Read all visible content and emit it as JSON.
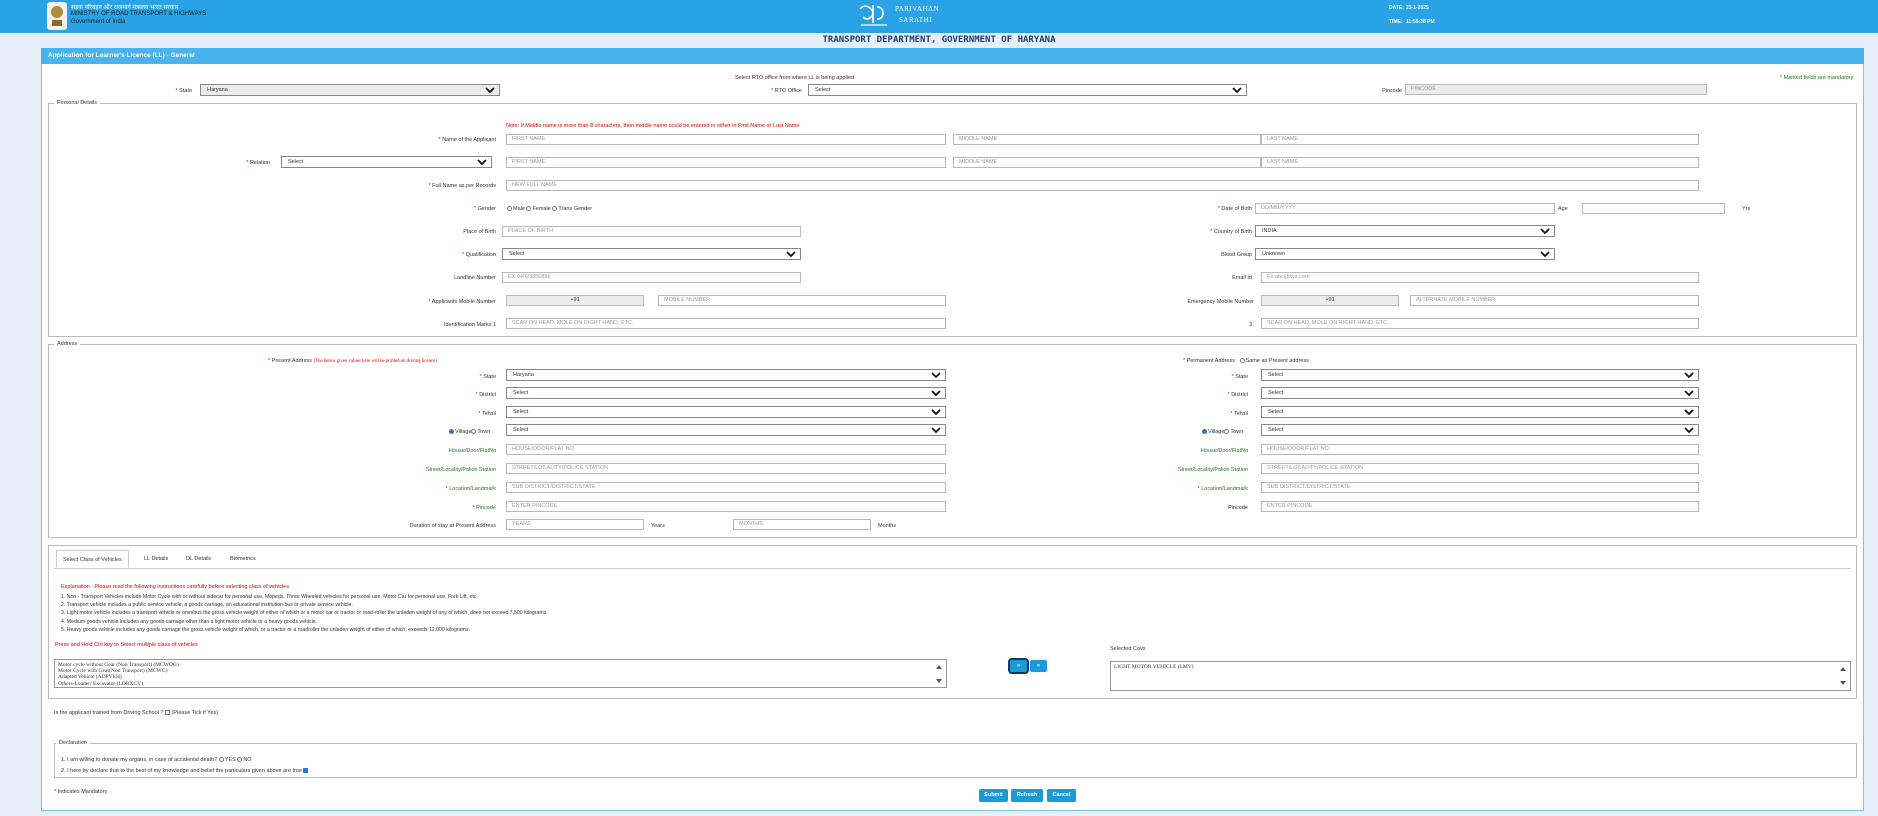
{
  "header": {
    "ministry_hindi": "सड़क परिवहन और राजमार्ग मंत्रालय भारत सरकार",
    "ministry": "MINISTRY OF ROAD TRANSPORT & HIGHWAYS",
    "gov": "Government of India",
    "logo_hindi": "परिवहन",
    "logo_line1": "PARIVAHAN",
    "logo_line2": "SARATHI",
    "date_label": "DATE:",
    "date_value": "23-1-2025",
    "time_label": "TIME:",
    "time_value": "11:55:38 PM",
    "department": "TRANSPORT DEPARTMENT, GOVERNMENT OF HARYANA"
  },
  "form": {
    "title": "Application for Learner's Licence (LL) - General",
    "rto_note": "Select RTO office from where LL is being applied",
    "mandatory_note": "* Marked fields are mandatory",
    "state_label": "State",
    "state_value": "Haryana",
    "rto_label": "RTO Office",
    "rto_value": "Select",
    "pincode_label": "Pincode",
    "pincode_placeholder": "PINCODE"
  },
  "personal": {
    "legend": "Personal Details",
    "middle_name_note": "Note: If Middle name is more than 8 characters, then middle name could be entered in either in First Name or Last Name",
    "name_label": "Name of the Applicant",
    "first_name": "FIRST NAME",
    "middle_name": "MIDDLE NAME",
    "last_name": "LAST NAME",
    "relation_label": "Relation",
    "relation_value": "Select",
    "fullname_label": "Full Name as per Records",
    "fullname_placeholder": "NEW FULL NAME",
    "gender_label": "Gender",
    "gender_male": "Male",
    "gender_female": "Female",
    "gender_trans": "Trans Gender",
    "dob_label": "Date of Birth",
    "dob_placeholder": "DD/MM/YYYY",
    "age_label": "Age",
    "age_unit": "Yrs",
    "pob_label": "Place of Birth",
    "pob_placeholder": "PLACE OF BIRTH",
    "country_label": "Country of Birth",
    "country_value": "INDIA",
    "qual_label": "Qualification",
    "qual_value": "Select",
    "blood_label": "Blood Group",
    "blood_value": "Unknown",
    "landline_label": "Landline Number",
    "landline_placeholder": "EX:04023856856",
    "email_label": "Email Id",
    "email_placeholder": "Ex:abc@xyz.com",
    "mobile_label": "Applicants Mobile Number",
    "mobile_code": "+91",
    "mobile_placeholder": "MOBILE NUMBER",
    "emergency_label": "Emergency Mobile Number",
    "emergency_code": "+91",
    "emergency_placeholder": "ALTERNATE MOBILE NUMBER",
    "idmark1_label": "Identification Marks 1",
    "idmark_placeholder": "SCAR ON HEAD, MOLE ON RIGHT HAND, ETC.",
    "idmark2_label": "2."
  },
  "address": {
    "legend": "Address",
    "present_label": "Present Address",
    "present_note": "(The below given values here will be printed on driving licence)",
    "permanent_label": "Permanent Address",
    "same_as_present": "Same as Present address",
    "state_label": "State",
    "present_state": "Haryana",
    "perm_state": "Select",
    "district_label": "District",
    "district_value": "Select",
    "tehsil_label": "Tehsil",
    "tehsil_value": "Select",
    "village_label": "Village",
    "town_label": "Town",
    "village_value": "Select",
    "house_label": "House/Door/FlatNo",
    "house_placeholder": "HOUSE/DOOR/FLAT NO",
    "street_label": "Street/Locality/Police Station",
    "street_placeholder": "STREET/LOCALITY/POLICE STATION",
    "location_label": "Location/Landmark",
    "location_placeholder": "SUB DISTRICT/DISTRICT/STATE",
    "pincode_label": "Pincode",
    "pincode_placeholder": "ENTER PINCODE",
    "duration_label": "Duration of stay at Present Address",
    "years_placeholder": "YEARS",
    "years_label": "Years",
    "months_placeholder": "MONTHS",
    "months_label": "Months"
  },
  "tabs": [
    "Select Class of Vehicles",
    "LL Details",
    "DL Details",
    "Biometrics"
  ],
  "vehicles": {
    "explanation_title": "Explanation : Please read the following instructions carefully before selecting class of vehicles",
    "explanations": [
      "1. Non - Transport Vehicles include Motor Cycle with or without sidecar for personal use, Mopeds, Three Wheeled vehicles for personal use, Motor Car for personal use, Fork Lift, etc.",
      "2. Transport vehicle includes a public service vehicle, a goods carriage, an educational institution bus or private service vehicle.",
      "3. Light motor vehicle includes a transport vehicle or omnibus the gross vehicle weight of either of which or a motor car or tractor or road-roller the unladen weight of any of which, does not exceed 7,500 kilograms.",
      "4. Medium goods vehicle includes any goods carriage other than a light motor vehicle or a heavy goods vehicle.",
      "5. Heavy goods vehicle includes any goods carriage the gross vehicle weight of which, or a tractor or a roadroller the unladen weight of either of which, exceeds 12,000 kilograms."
    ],
    "ctrl_note": "Press and Hold Ctrl key to Select multiple class of vehicles",
    "options": [
      "Motor cycle without Gear (Non Transport) (MCWOG)",
      "Motor Cycle with Gear(Non Transport) (MCWG)",
      "Adapted Vehicle (ADPVEH)",
      "Others-Loader/ Excavator (LDRXCV)"
    ],
    "add_btn": "»",
    "remove_btn": "«",
    "selected_label": "Selected Covs",
    "selected": [
      "LIGHT MOTOR VEHICLE (LMV)"
    ],
    "driving_school": "Is the applicant trained from Driving School ?",
    "driving_school_tick": "(Please Tick if Yes)"
  },
  "declaration": {
    "legend": "Declaration",
    "q1": "1. I am willing to donate my organs, in case of accidental death?",
    "yes": "YES",
    "no": "NO",
    "q2": "2. I here by declare that to the best of my knowledge and belief the particulars given above are true"
  },
  "footer": {
    "mandatory": "* Indicates Mandatory",
    "submit": "Submit",
    "refresh": "Refresh",
    "cancel": "Cancel"
  }
}
